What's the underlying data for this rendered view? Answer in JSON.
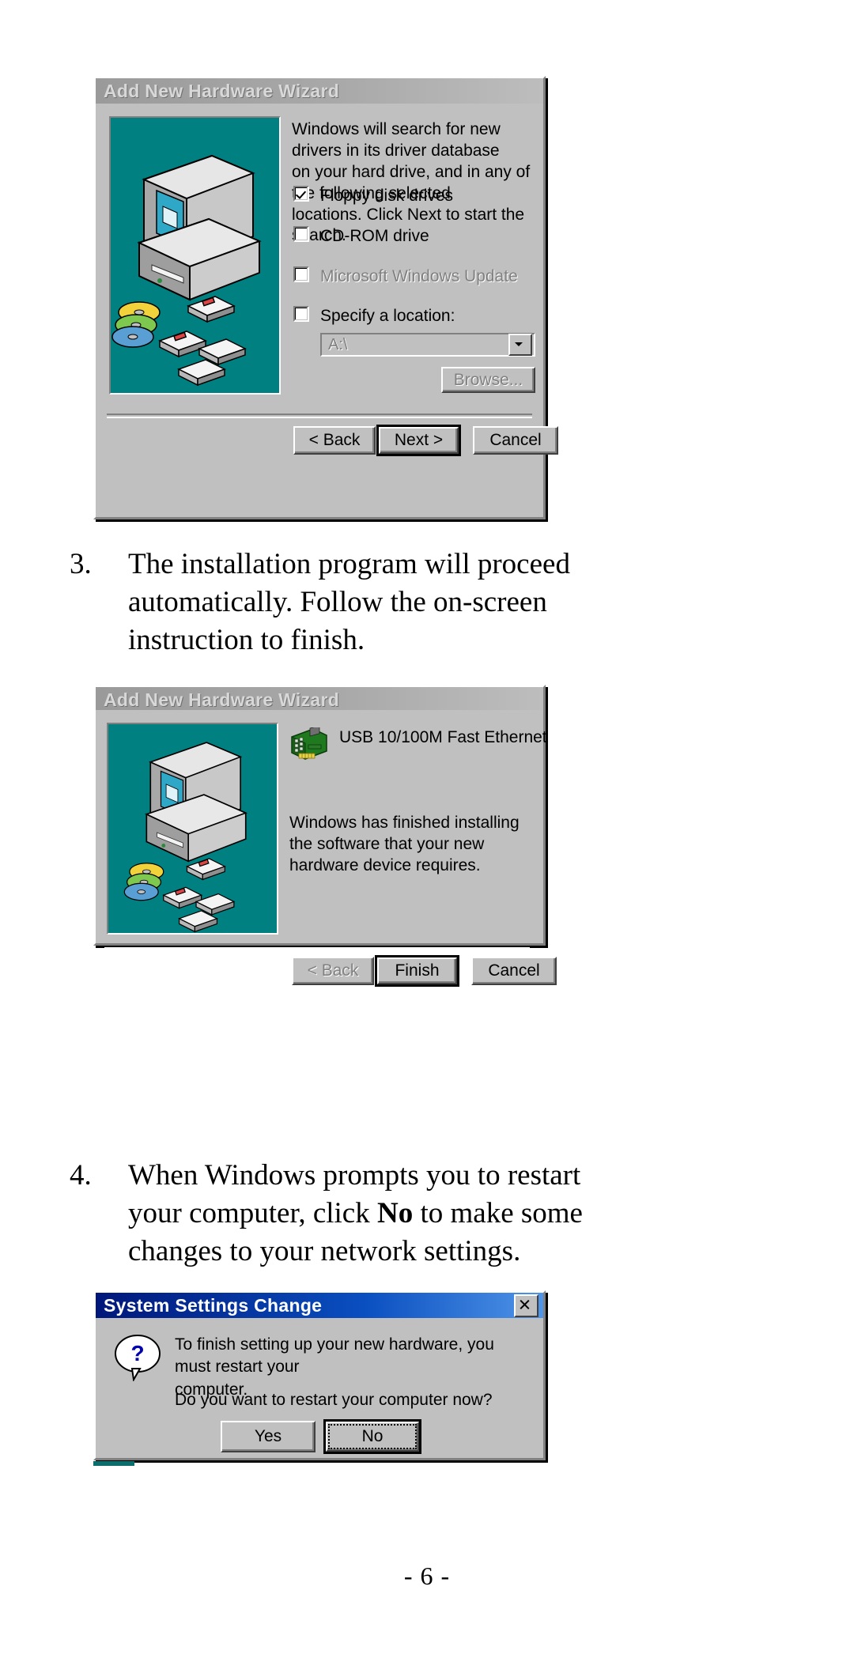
{
  "document": {
    "page_number": "- 6 -"
  },
  "steps": [
    {
      "number": "3.",
      "line1": "The installation program will proceed",
      "line2": "automatically. Follow the on-screen",
      "line3": "instruction to finish."
    },
    {
      "number": "4.",
      "line1": "When Windows prompts you to restart",
      "line2a": "your computer, click ",
      "line2b": "No",
      "line2c": " to make some",
      "line3": "changes to your network settings."
    }
  ],
  "dialog1": {
    "title": "Add New Hardware Wizard",
    "body_line1": "Windows will search for new drivers in its driver database",
    "body_line2": "on your hard drive, and in any of the following selected",
    "body_line3": "locations. Click Next to start the search.",
    "checkboxes": [
      {
        "label": "Floppy disk drives",
        "accel": "F",
        "checked": true,
        "enabled": true
      },
      {
        "label": "CD-ROM drive",
        "accel": "C",
        "checked": false,
        "enabled": true
      },
      {
        "label": "Microsoft Windows Update",
        "accel": "M",
        "checked": false,
        "enabled": false
      },
      {
        "label": "Specify a location:",
        "accel": "l",
        "checked": false,
        "enabled": true
      }
    ],
    "location_value": "A:\\",
    "browse_label": "Browse...",
    "buttons": [
      {
        "label": "< Back",
        "state": "normal"
      },
      {
        "label": "Next >",
        "state": "default"
      },
      {
        "label": "Cancel",
        "state": "normal"
      }
    ]
  },
  "dialog2": {
    "title": "Add New Hardware Wizard",
    "device_name": "USB 10/100M Fast Ethernet",
    "body_line1": "Windows has finished installing the software that your new",
    "body_line2": "hardware device requires.",
    "buttons": [
      {
        "label": "< Back",
        "state": "disabled"
      },
      {
        "label": "Finish",
        "state": "default"
      },
      {
        "label": "Cancel",
        "state": "normal"
      }
    ]
  },
  "dialog3": {
    "title": "System Settings Change",
    "close_label": "Close",
    "icon": "question-icon",
    "body_line1": "To finish setting up your new hardware, you must restart your",
    "body_line2": "computer.",
    "body_line3": "Do you want to restart your computer now?",
    "buttons": [
      {
        "label": "Yes",
        "accel": "Y",
        "state": "normal"
      },
      {
        "label": "No",
        "accel": "N",
        "state": "default-focus"
      }
    ]
  },
  "colors": {
    "face": "#c0c0c0",
    "teal": "#008080",
    "title_active": "#0a4fc0",
    "title_inactive": "#a9a9a9"
  }
}
